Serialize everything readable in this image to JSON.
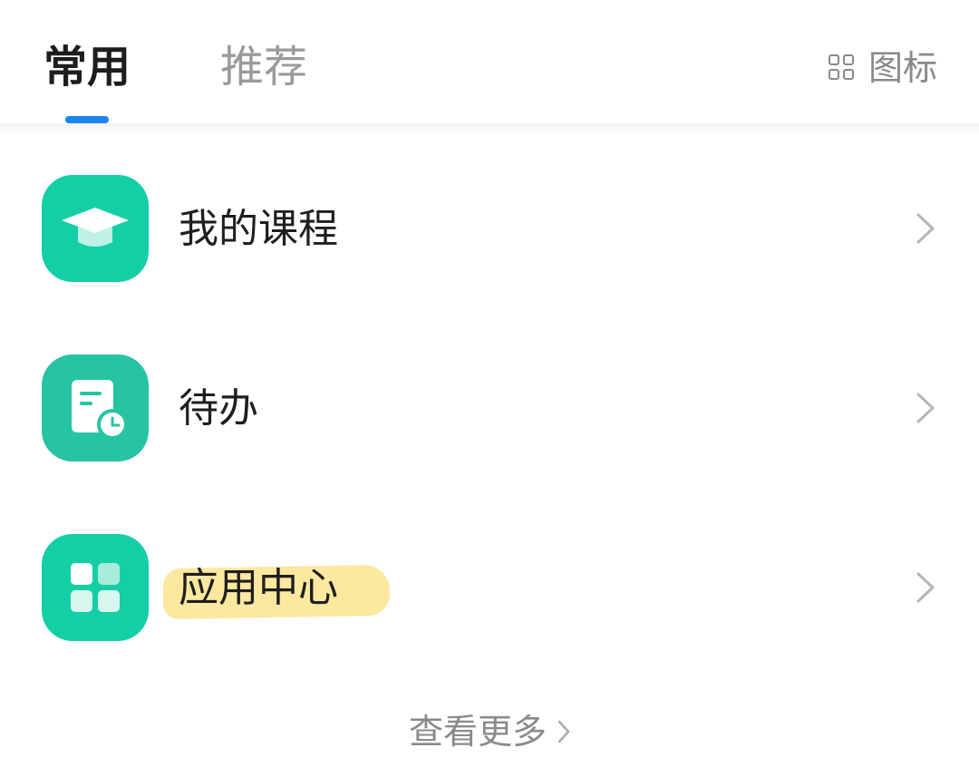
{
  "header": {
    "tabs": [
      {
        "label": "常用",
        "active": true
      },
      {
        "label": "推荐",
        "active": false
      }
    ],
    "view_toggle": {
      "icon": "grid-icon",
      "label": "图标"
    },
    "accent_color": "#1a86ee"
  },
  "list": {
    "items": [
      {
        "label": "我的课程",
        "icon": "graduation-cap-icon",
        "color": "#14cfa6"
      },
      {
        "label": "待办",
        "icon": "todo-clock-icon",
        "color": "#26c4a3"
      },
      {
        "label": "应用中心",
        "icon": "app-grid-icon",
        "color": "#14cfa6",
        "highlighted": true
      }
    ]
  },
  "footer": {
    "more_label": "查看更多"
  }
}
